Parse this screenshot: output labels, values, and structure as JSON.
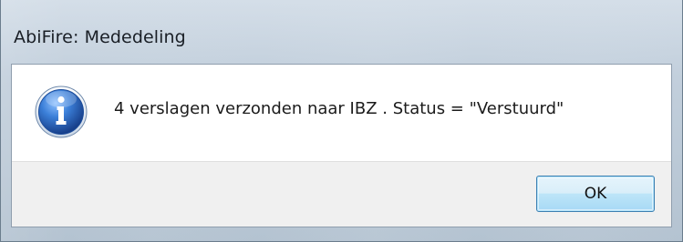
{
  "window": {
    "title": "AbiFire: Mededeling"
  },
  "dialog": {
    "icon": "info-icon",
    "message": "4 verslagen verzonden naar IBZ . Status  = \"Verstuurd\"",
    "ok_label": "OK"
  },
  "colors": {
    "icon_blue": "#2f6fc4",
    "button_border": "#3c7fb1",
    "footer_bg": "#f0f0f0"
  }
}
